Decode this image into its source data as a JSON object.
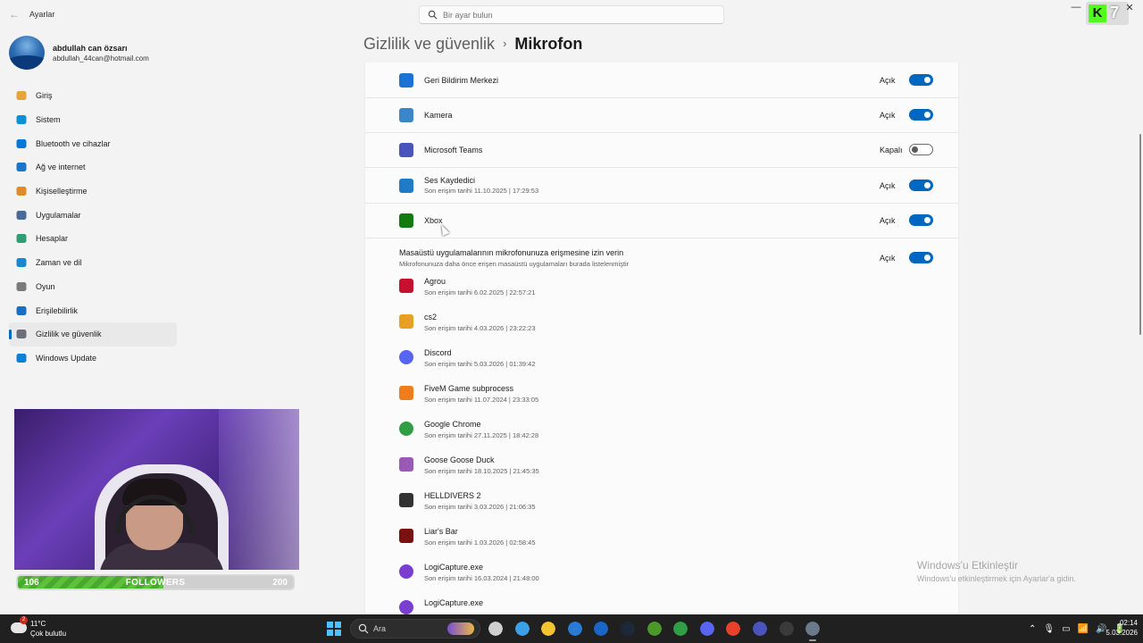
{
  "window": {
    "title": "Ayarlar",
    "back_label": "←",
    "search_placeholder": "Bir ayar bulun",
    "minimize_label": "—",
    "close_label": "✕"
  },
  "overlay": {
    "kick_letter": "K",
    "kick_count": "7",
    "followers": {
      "current": "106",
      "label": "FOLLOWERS",
      "goal": "200",
      "progress": 0.53
    }
  },
  "profile": {
    "name": "abdullah can özsarı",
    "email": "abdullah_44can@hotmail.com"
  },
  "sidebar": {
    "items": [
      {
        "label": "Giriş",
        "icon": "home-icon",
        "color": "#e8a33a"
      },
      {
        "label": "Sistem",
        "icon": "system-icon",
        "color": "#0f8fd6"
      },
      {
        "label": "Bluetooth ve cihazlar",
        "icon": "bluetooth-icon",
        "color": "#0078d4"
      },
      {
        "label": "Ağ ve internet",
        "icon": "network-icon",
        "color": "#1a75c9"
      },
      {
        "label": "Kişiselleştirme",
        "icon": "brush-icon",
        "color": "#e08a2a"
      },
      {
        "label": "Uygulamalar",
        "icon": "apps-icon",
        "color": "#4a6a9a"
      },
      {
        "label": "Hesaplar",
        "icon": "accounts-icon",
        "color": "#2e9e77"
      },
      {
        "label": "Zaman ve dil",
        "icon": "time-language-icon",
        "color": "#1a87d0"
      },
      {
        "label": "Oyun",
        "icon": "gaming-icon",
        "color": "#7a7a7a"
      },
      {
        "label": "Erişilebilirlik",
        "icon": "accessibility-icon",
        "color": "#1a6fc4"
      },
      {
        "label": "Gizlilik ve güvenlik",
        "icon": "shield-icon",
        "color": "#6a6f7a",
        "active": true
      },
      {
        "label": "Windows Update",
        "icon": "windows-update-icon",
        "color": "#0f7fd0"
      }
    ]
  },
  "page": {
    "breadcrumb_parent": "Gizlilik ve güvenlik",
    "breadcrumb_sep": "›",
    "title": "Mikrofon"
  },
  "store_apps": [
    {
      "name": "Geri Bildirim Merkezi",
      "sub": "",
      "state": "Açık",
      "on": true,
      "icon": "feedback-hub-icon",
      "color": "#1a73d4"
    },
    {
      "name": "Kamera",
      "sub": "",
      "state": "Açık",
      "on": true,
      "icon": "camera-icon",
      "color": "#3a86c8"
    },
    {
      "name": "Microsoft Teams",
      "sub": "",
      "state": "Kapalı",
      "on": false,
      "icon": "teams-icon",
      "color": "#4b53bc"
    },
    {
      "name": "Ses Kaydedici",
      "sub": "Son erişim tarihi 11.10.2025  |  17:29:53",
      "state": "Açık",
      "on": true,
      "icon": "voice-recorder-icon",
      "color": "#1e7bc8"
    },
    {
      "name": "Xbox",
      "sub": "",
      "state": "Açık",
      "on": true,
      "icon": "xbox-icon",
      "color": "#107c10"
    }
  ],
  "desktop": {
    "title": "Masaüstü uygulamalarının mikrofonunuza erişmesine izin verin",
    "subtitle": "Mikrofonunuza daha önce erişen masaüstü uygulamaları burada listelenmiştir",
    "state": "Açık",
    "on": true,
    "apps": [
      {
        "name": "Agrou",
        "sub": "Son erişim tarihi 6.02.2025  |  22:57:21",
        "icon": "agrou-icon",
        "color": "#c8102e"
      },
      {
        "name": "cs2",
        "sub": "Son erişim tarihi 4.03.2026  |  23:22:23",
        "icon": "cs2-icon",
        "color": "#e8a020"
      },
      {
        "name": "Discord",
        "sub": "Son erişim tarihi 5.03.2026  |  01:39:42",
        "icon": "discord-icon",
        "color": "#5865f2"
      },
      {
        "name": "FiveM Game subprocess",
        "sub": "Son erişim tarihi 11.07.2024  |  23:33:05",
        "icon": "fivem-icon",
        "color": "#f07d1a"
      },
      {
        "name": "Google Chrome",
        "sub": "Son erişim tarihi 27.11.2025  |  18:42:28",
        "icon": "chrome-icon",
        "color": "#2f9e44"
      },
      {
        "name": "Goose Goose Duck",
        "sub": "Son erişim tarihi 18.10.2025  |  21:45:35",
        "icon": "goose-goose-duck-icon",
        "color": "#9b59b6"
      },
      {
        "name": "HELLDIVERS 2",
        "sub": "Son erişim tarihi 3.03.2026  |  21:06:35",
        "icon": "helldivers-icon",
        "color": "#333333"
      },
      {
        "name": "Liar's Bar",
        "sub": "Son erişim tarihi 1.03.2026  |  02:58:45",
        "icon": "liars-bar-icon",
        "color": "#7a1010"
      },
      {
        "name": "LogiCapture.exe",
        "sub": "Son erişim tarihi 16.03.2024  |  21:48:00",
        "icon": "logicapture-icon",
        "color": "#7a3fd0"
      },
      {
        "name": "LogiCapture.exe",
        "sub": "",
        "icon": "logicapture-icon",
        "color": "#7a3fd0"
      }
    ]
  },
  "watermark": {
    "title": "Windows'u Etkinleştir",
    "subtitle": "Windows'u etkinleştirmek için Ayarlar'a gidin."
  },
  "taskbar": {
    "weather_temp": "11°C",
    "weather_cond": "Çok bulutlu",
    "weather_badge": "2",
    "search_label": "Ara",
    "pinned": [
      {
        "name": "task-view-icon",
        "color": "#cfcfcf"
      },
      {
        "name": "desktop-icon",
        "color": "#3aa0e8"
      },
      {
        "name": "file-explorer-icon",
        "color": "#f4c430"
      },
      {
        "name": "store-icon",
        "color": "#2a7bd6"
      },
      {
        "name": "outlook-icon",
        "color": "#1a66c8"
      },
      {
        "name": "steam-icon",
        "color": "#1b2838"
      },
      {
        "name": "minecraft-icon",
        "color": "#4a9a2a"
      },
      {
        "name": "chrome-icon",
        "color": "#2f9e44"
      },
      {
        "name": "discord-icon",
        "color": "#5865f2"
      },
      {
        "name": "media-player-icon",
        "color": "#e8402a"
      },
      {
        "name": "teams-icon",
        "color": "#4b53bc"
      },
      {
        "name": "obs-icon",
        "color": "#3a3a3a"
      },
      {
        "name": "settings-icon",
        "color": "#6a7a8a",
        "active": true
      }
    ],
    "tray": [
      "⌃",
      "🎙",
      "▭",
      "📶",
      "🔊",
      "🔋"
    ],
    "time": "02:14",
    "date": "5.03.2026"
  }
}
